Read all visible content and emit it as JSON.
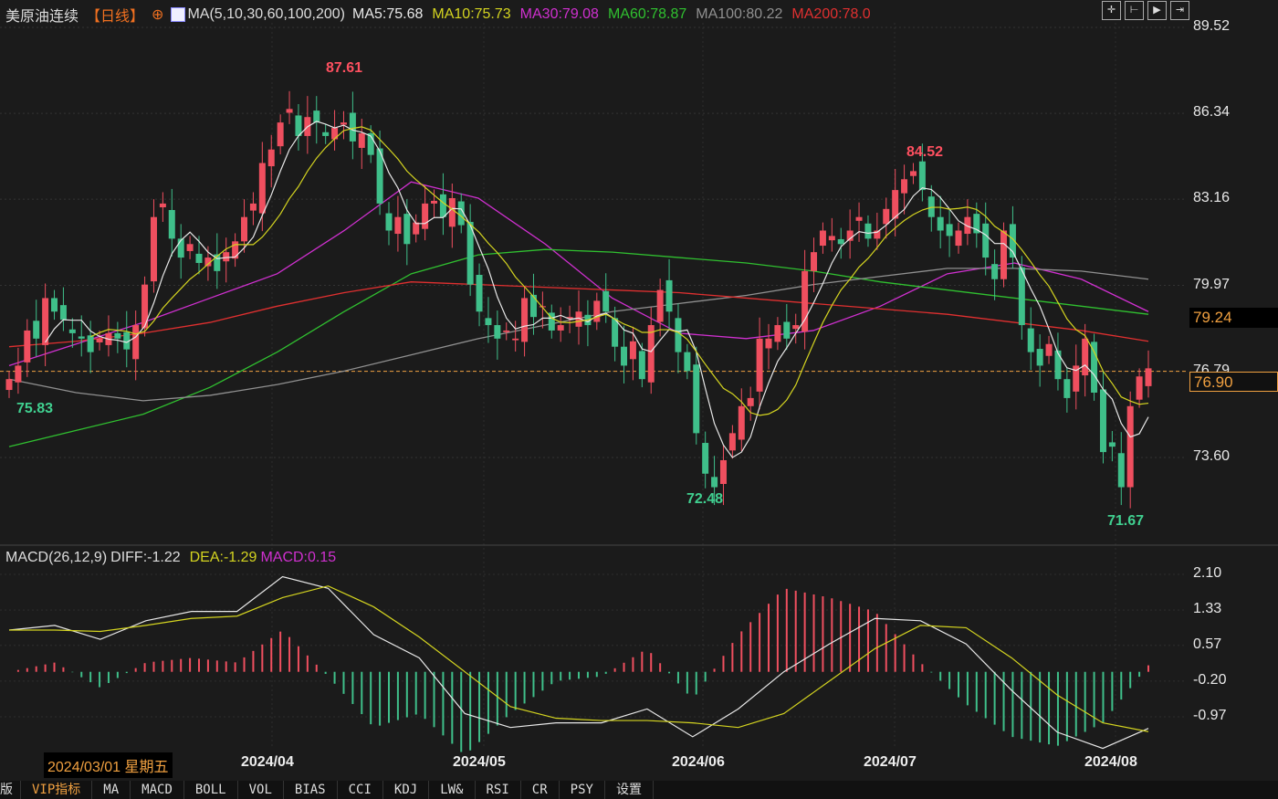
{
  "header": {
    "title": "美原油连续",
    "period": "【日线】",
    "ma_label": "MA(5,10,30,60,100,200)",
    "ma": [
      {
        "label": "MA5:75.68",
        "color": "#e8e8e8"
      },
      {
        "label": "MA10:75.73",
        "color": "#d4d420"
      },
      {
        "label": "MA30:79.08",
        "color": "#d030d0"
      },
      {
        "label": "MA60:78.87",
        "color": "#30c030"
      },
      {
        "label": "MA100:80.22",
        "color": "#909090"
      },
      {
        "label": "MA200:78.0",
        "color": "#e03030"
      }
    ]
  },
  "toolbar": [
    "crosshair-icon",
    "zoom-range-icon",
    "play-icon",
    "goto-latest-icon"
  ],
  "price_axis": {
    "min": 73.6,
    "max": 89.52,
    "ticks": [
      "89.52",
      "86.34",
      "83.16",
      "79.97",
      "76.79",
      "73.60"
    ],
    "box_ma": "79.24",
    "box_last": "76.90",
    "last": 76.9,
    "dashed_level": 76.79
  },
  "annotations": [
    {
      "label": "87.61",
      "type": "high",
      "color": "#ff5060"
    },
    {
      "label": "84.52",
      "type": "high",
      "color": "#ff5060"
    },
    {
      "label": "72.48",
      "type": "low",
      "color": "#40d090"
    },
    {
      "label": "71.67",
      "type": "low",
      "color": "#40d090"
    },
    {
      "label": "75.83",
      "type": "low",
      "color": "#40d090"
    }
  ],
  "colors": {
    "up": "#ef4f5f",
    "down": "#3fbf8a",
    "background": "#1b1b1b",
    "accent": "#f0a040"
  },
  "chart_data": {
    "type": "candlestick",
    "closes": [
      76.5,
      77.0,
      78.3,
      78.0,
      79.5,
      79.0,
      78.7,
      78.2,
      78.0,
      77.5,
      78.0,
      78.2,
      78.0,
      77.6,
      78.5,
      80.0,
      82.5,
      83.0,
      81.7,
      81.0,
      81.5,
      80.8,
      81.0,
      80.5,
      81.2,
      81.6,
      82.5,
      83.0,
      84.5,
      85.0,
      86.0,
      86.5,
      85.5,
      86.2,
      86.0,
      85.5,
      85.8,
      86.0,
      85.3,
      85.6,
      84.8,
      83.0,
      82.0,
      82.5,
      81.5,
      82.3,
      83.0,
      83.1,
      82.5,
      83.2,
      82.2,
      80.0,
      79.0,
      78.5,
      78.0,
      78.3,
      78.0,
      79.5,
      78.8,
      79.2,
      78.3,
      78.5,
      78.8,
      79.0,
      78.5,
      79.4,
      79.0,
      77.7,
      77.0,
      77.9,
      76.5,
      78.5,
      79.8,
      79.0,
      77.5,
      76.8,
      74.5,
      73.0,
      72.5,
      73.5,
      74.5,
      75.5,
      75.8,
      78.0,
      78.0,
      78.5,
      78.0,
      78.5,
      80.5,
      81.2,
      82.0,
      81.8,
      81.5,
      82.0,
      82.5,
      81.7,
      82.0,
      82.8,
      83.5,
      83.9,
      84.2,
      83.5,
      82.5,
      82.0,
      81.8,
      82.0,
      82.5,
      81.9,
      81.0,
      80.2,
      82.0,
      81.0,
      78.5,
      77.5,
      77.0,
      77.8,
      76.5,
      75.8,
      77.0,
      78.0,
      76.0,
      73.8,
      74.0,
      72.5,
      75.5,
      76.6,
      76.9
    ],
    "ma_lines": [
      {
        "name": "MA30",
        "color": "#d030d0",
        "values": [
          77.0,
          77.8,
          78.6,
          79.5,
          80.4,
          82.0,
          83.8,
          83.2,
          81.5,
          79.5,
          78.2,
          78.0,
          78.3,
          79.2,
          80.4,
          80.8,
          80.2,
          79.0
        ]
      },
      {
        "name": "MA60",
        "color": "#30c030",
        "values": [
          74.0,
          74.6,
          75.2,
          76.2,
          77.5,
          79.0,
          80.4,
          81.1,
          81.3,
          81.2,
          81.0,
          80.8,
          80.5,
          80.1,
          79.8,
          79.5,
          79.2,
          78.9
        ]
      },
      {
        "name": "MA100",
        "color": "#909090",
        "values": [
          76.5,
          76.0,
          75.7,
          75.9,
          76.3,
          76.8,
          77.4,
          78.0,
          78.5,
          79.0,
          79.3,
          79.6,
          80.0,
          80.3,
          80.6,
          80.6,
          80.5,
          80.2
        ]
      },
      {
        "name": "MA200",
        "color": "#e03030",
        "values": [
          77.7,
          77.9,
          78.2,
          78.6,
          79.2,
          79.7,
          80.1,
          80.0,
          79.9,
          79.8,
          79.7,
          79.5,
          79.3,
          79.1,
          78.9,
          78.6,
          78.3,
          77.9
        ]
      }
    ],
    "x_ticks": [
      "2024/04",
      "2024/05",
      "2024/06",
      "2024/07",
      "2024/08"
    ]
  },
  "macd": {
    "label": "MACD(26,12,9)",
    "diff_label": "DIFF:-1.22",
    "dea_label": "DEA:-1.29",
    "macd_label": "MACD:0.15",
    "ticks": [
      "2.10",
      "1.33",
      "0.57",
      "-0.20",
      "-0.97"
    ],
    "min": -0.97,
    "max": 2.1,
    "diff": [
      0.9,
      1.0,
      0.7,
      1.1,
      1.3,
      1.3,
      2.05,
      1.8,
      0.8,
      0.3,
      -0.9,
      -1.2,
      -1.1,
      -1.1,
      -0.8,
      -1.4,
      -0.8,
      0.0,
      0.6,
      1.15,
      1.1,
      0.6,
      -0.4,
      -1.3,
      -1.65,
      -1.22
    ],
    "dea": [
      0.9,
      0.9,
      0.87,
      1.0,
      1.15,
      1.2,
      1.6,
      1.85,
      1.4,
      0.75,
      0.0,
      -0.75,
      -1.0,
      -1.05,
      -1.05,
      -1.1,
      -1.2,
      -0.9,
      -0.2,
      0.5,
      1.0,
      0.95,
      0.3,
      -0.5,
      -1.1,
      -1.29
    ]
  },
  "crosshair_date": "2024/03/01 星期五",
  "tabs": [
    "版",
    "VIP指标",
    "MA",
    "MACD",
    "BOLL",
    "VOL",
    "BIAS",
    "CCI",
    "KDJ",
    "LW&",
    "RSI",
    "CR",
    "PSY",
    "设置"
  ]
}
